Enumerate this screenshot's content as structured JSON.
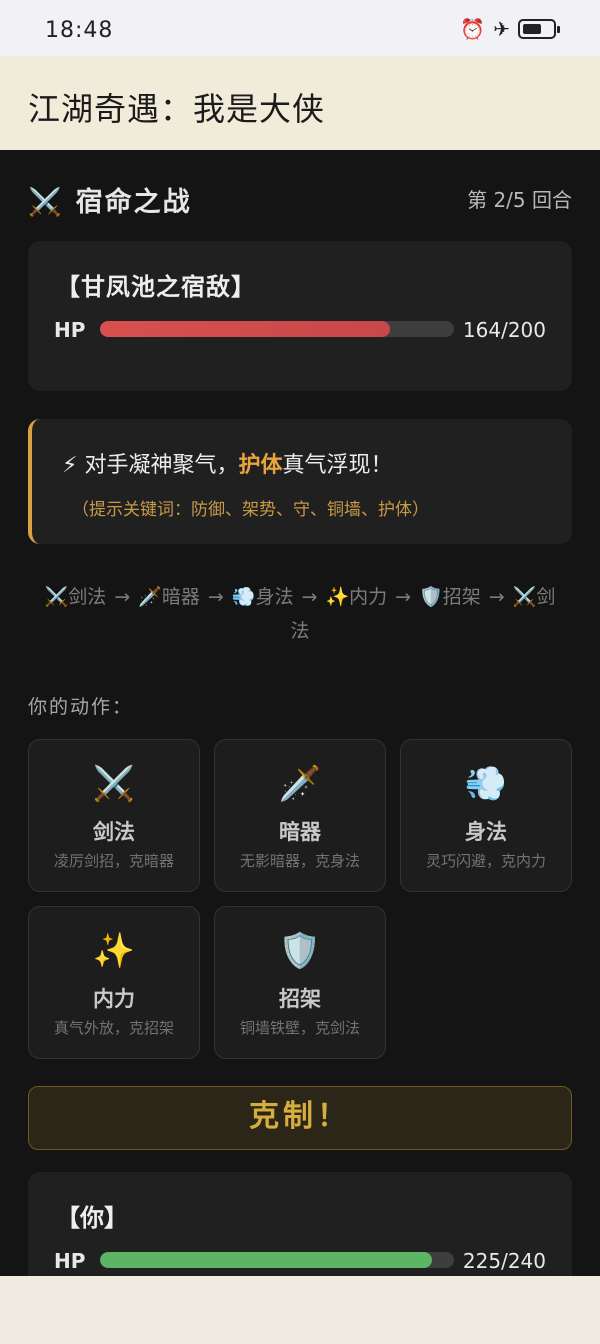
{
  "status": {
    "time": "18:48",
    "icons": [
      "alarm-icon",
      "airplane-icon",
      "battery-icon"
    ]
  },
  "app": {
    "title": "江湖奇遇：我是大侠"
  },
  "battle": {
    "icon": "⚔️",
    "title": "宿命之战",
    "round": "第 2/5 回合"
  },
  "enemy": {
    "name": "【甘凤池之宿敌】",
    "hp_label": "HP",
    "hp_current": 164,
    "hp_max": 200,
    "hp_text": "164/200"
  },
  "hint": {
    "icon": "⚡",
    "prefix": "对手凝神聚气，",
    "keyword": "护体",
    "suffix": "真气浮现！",
    "sub": "（提示关键词：防御、架势、守、铜墙、护体）"
  },
  "chain": [
    {
      "icon": "⚔️",
      "label": "剑法"
    },
    {
      "icon": "🗡️",
      "label": "暗器"
    },
    {
      "icon": "💨",
      "label": "身法"
    },
    {
      "icon": "✨",
      "label": "内力"
    },
    {
      "icon": "🛡️",
      "label": "招架"
    },
    {
      "icon": "⚔️",
      "label": "剑法"
    }
  ],
  "chain_arrow": "→",
  "actions_label": "你的动作：",
  "moves": [
    {
      "icon": "⚔️",
      "name": "剑法",
      "desc": "凌厉剑招，克暗器"
    },
    {
      "icon": "🗡️",
      "name": "暗器",
      "desc": "无影暗器，克身法"
    },
    {
      "icon": "💨",
      "name": "身法",
      "desc": "灵巧闪避，克内力"
    },
    {
      "icon": "✨",
      "name": "内力",
      "desc": "真气外放，克招架"
    },
    {
      "icon": "🛡️",
      "name": "招架",
      "desc": "铜墙铁壁，克剑法"
    }
  ],
  "counter_button": "克制！",
  "player": {
    "name": "【你】",
    "hp_label": "HP",
    "hp_current": 225,
    "hp_max": 240,
    "hp_text": "225/240"
  },
  "colors": {
    "accent": "#e9a43b",
    "enemy_hp": "#d9504e",
    "player_hp": "#5cb464",
    "background": "#141414"
  }
}
